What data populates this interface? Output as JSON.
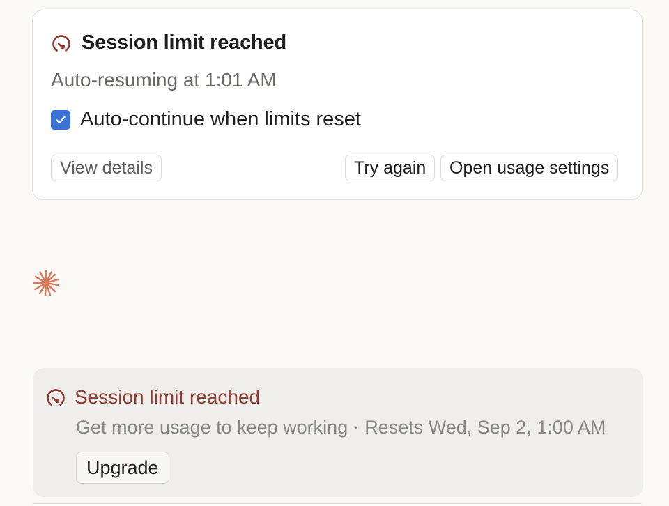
{
  "limit_card": {
    "title": "Session limit reached",
    "subtitle": "Auto-resuming at 1:01 AM",
    "auto_continue": {
      "label": "Auto-continue when limits reset",
      "checked": true
    },
    "buttons": {
      "view_details": "View details",
      "try_again": "Try again",
      "open_usage_settings": "Open usage settings"
    }
  },
  "spinner": {
    "icon": "spark-asterisk-icon",
    "color": "#d97757"
  },
  "usage_banner": {
    "title": "Session limit reached",
    "info": "Get more usage to keep working · Resets Wed, Sep 2, 1:00 AM",
    "upgrade_label": "Upgrade"
  },
  "colors": {
    "accent_red": "#8c3a33",
    "checkbox_blue": "#3a72d6",
    "background": "#faf9f6"
  }
}
